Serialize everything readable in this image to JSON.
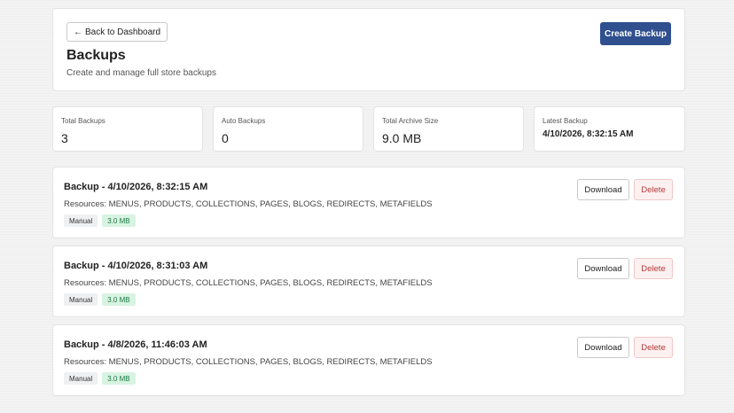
{
  "header": {
    "back_label": "Back to Dashboard",
    "back_arrow": "←",
    "title": "Backups",
    "subtitle": "Create and manage full store backups",
    "create_label": "Create Backup"
  },
  "stats": [
    {
      "label": "Total Backups",
      "value": "3"
    },
    {
      "label": "Auto Backups",
      "value": "0"
    },
    {
      "label": "Total Archive Size",
      "value": "9.0 MB"
    },
    {
      "label": "Latest Backup",
      "value": "4/10/2026, 8:32:15 AM"
    }
  ],
  "backups": [
    {
      "title": "Backup - 4/10/2026, 8:32:15 AM",
      "resources": "Resources: MENUS, PRODUCTS, COLLECTIONS, PAGES, BLOGS, REDIRECTS, METAFIELDS",
      "type": "Manual",
      "size": "3.0 MB",
      "download_label": "Download",
      "delete_label": "Delete"
    },
    {
      "title": "Backup - 4/10/2026, 8:31:03 AM",
      "resources": "Resources: MENUS, PRODUCTS, COLLECTIONS, PAGES, BLOGS, REDIRECTS, METAFIELDS",
      "type": "Manual",
      "size": "3.0 MB",
      "download_label": "Download",
      "delete_label": "Delete"
    },
    {
      "title": "Backup - 4/8/2026, 11:46:03 AM",
      "resources": "Resources: MENUS, PRODUCTS, COLLECTIONS, PAGES, BLOGS, REDIRECTS, METAFIELDS",
      "type": "Manual",
      "size": "3.0 MB",
      "download_label": "Download",
      "delete_label": "Delete"
    }
  ],
  "colors": {
    "primary": "#2f4f8f",
    "danger": "#b23a3a",
    "success_badge": "#d8f3e2"
  }
}
